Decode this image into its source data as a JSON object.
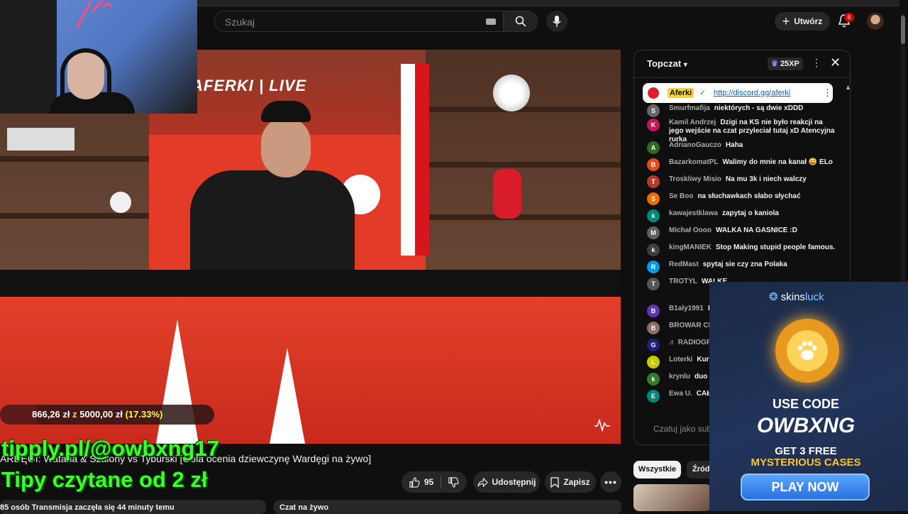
{
  "search": {
    "placeholder": "Szukaj"
  },
  "header": {
    "create_label": "Utwórz",
    "notifications_count": "6"
  },
  "video": {
    "brand_text": "AFERKI | LIVE",
    "title": "ARDĘGI: Wataha & Szalony vs Tyburski [Gola ocenia dziewczynę Wardęgi na żywo]",
    "likes": "95",
    "share_label": "Udostępnij",
    "save_label": "Zapisz",
    "description": "85 osób  Transmisja zaczęła się 44 minuty temu",
    "chat_label": "Czat na żywo"
  },
  "overlay": {
    "goal_current": "866,26 zł",
    "goal_separator": "z",
    "goal_target": "5000,00 zł",
    "goal_percent": "(17.33%)",
    "goal_fraction": 0.1733,
    "tip_line1": "tipply.pl/@owbxng17",
    "tip_line2": "Tipy czytane od 2 zł"
  },
  "chat": {
    "title": "Topczat",
    "xp": "25XP",
    "pinned": {
      "author": "Aferki",
      "link": "http://discord.gg/aferki"
    },
    "messages": [
      {
        "initial": "S",
        "color": "#666666",
        "author": "Smurfmafija",
        "text": "niektórych - są dwie xDDD"
      },
      {
        "initial": "K",
        "color": "#c2185b",
        "author": "Kamil Andrzej",
        "text": "Dzigi na KS nie było reakcji na jego wejście na czat przyleciał tutaj xD Atencyjna rurka"
      },
      {
        "initial": "A",
        "color": "#33691e",
        "author": "AdrianoGauczo",
        "text": "Haha"
      },
      {
        "initial": "B",
        "color": "#e64a19",
        "author": "BazarkomatPL",
        "text": "Walimy do mnie na kanał 😀 ELo"
      },
      {
        "initial": "T",
        "color": "#b53a2a",
        "author": "Troskliwy Misio",
        "text": "Na mu 3k i niech walczy"
      },
      {
        "initial": "S",
        "color": "#ef6c00",
        "author": "Se Boo",
        "text": "na słuchawkach słabo słychać"
      },
      {
        "initial": "k",
        "color": "#00897b",
        "author": "kawajestklawa",
        "text": "zapytaj o kaniola"
      },
      {
        "initial": "M",
        "color": "#616161",
        "author": "Michał Oooo",
        "text": "WALKA NA GASNICE :D"
      },
      {
        "initial": "k",
        "color": "#3e3e3e",
        "author": "kingMANIEK",
        "text": "Stop Making stupid people famous."
      },
      {
        "initial": "R",
        "color": "#039be5",
        "author": "RedMast",
        "text": "spytaj sie czy zna Polaka"
      },
      {
        "initial": "T",
        "color": "#555555",
        "author": "TROTYL",
        "text": "WALKĘ"
      },
      {
        "initial": "B",
        "color": "#5e35b1",
        "author": "B1aly1991",
        "text": "B"
      },
      {
        "initial": "B",
        "color": "#8d6e63",
        "author": "BROWAR CH",
        "text": ""
      },
      {
        "initial": "G",
        "color": "#1a237e",
        "author": "♬ RADIOGP",
        "text": ""
      },
      {
        "initial": "L",
        "color": "#c6cc00",
        "author": "Loterki",
        "text": "Kurc"
      },
      {
        "initial": "k",
        "color": "#2e7d32",
        "author": "krynlu",
        "text": "duo z"
      },
      {
        "initial": "E",
        "color": "#00897b",
        "author": "Ewa U.",
        "text": "CAŁY !!!!!!!!!!"
      }
    ],
    "input_placeholder": "Czatuj jako subskrybent"
  },
  "filters": {
    "all": "Wszystkie",
    "source": "Źródło"
  },
  "ad": {
    "logo_a": "skins",
    "logo_b": "luck",
    "use_code": "USE CODE",
    "code": "OWBXNG",
    "get": "GET 3 FREE",
    "mysterious": "MYSTERIOUS CASES",
    "play": "PLAY NOW"
  },
  "colors": {
    "accent_green": "#3cff2a",
    "goal_yellow": "#f5ff3a",
    "yt_red": "#cc0000"
  }
}
